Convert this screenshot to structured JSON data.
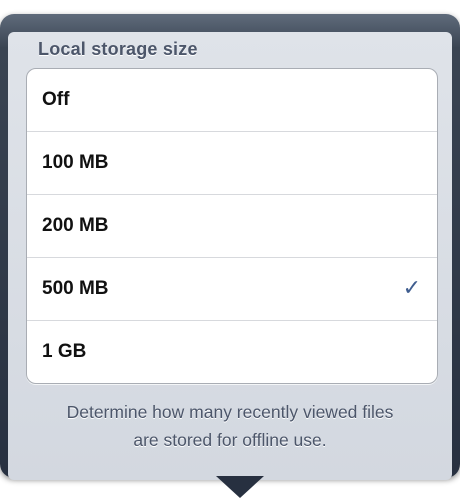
{
  "popover": {
    "title": "Local storage size",
    "options": [
      {
        "label": "Off",
        "selected": false
      },
      {
        "label": "100 MB",
        "selected": false
      },
      {
        "label": "200 MB",
        "selected": false
      },
      {
        "label": "500 MB",
        "selected": true
      },
      {
        "label": "1 GB",
        "selected": false
      }
    ],
    "checkmark": "✓",
    "footer_line1": "Determine how many recently viewed files",
    "footer_line2": "are stored for offline use."
  },
  "colors": {
    "accent_check": "#3f5d8f",
    "header_text": "#4c566a",
    "popover_frame": "#273040"
  },
  "icons": {
    "selected_indicator": "checkmark-icon",
    "popover_pointer": "popover-arrow"
  }
}
